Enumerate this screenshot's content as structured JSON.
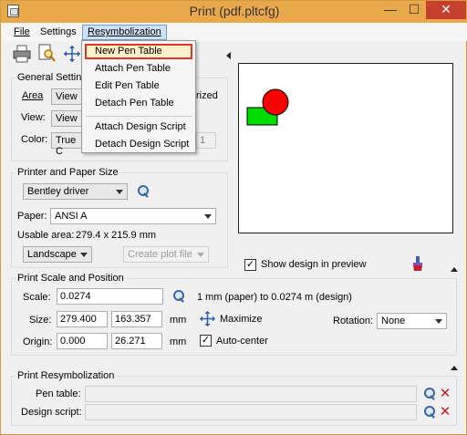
{
  "window": {
    "title": "Print  (pdf.pltcfg)",
    "minimize_glyph": "—",
    "maximize_glyph": "☐",
    "close_glyph": "✕"
  },
  "menubar": {
    "file": "File",
    "settings": "Settings",
    "resymbolization": "Resymbolization"
  },
  "dropdown": {
    "items": [
      "New Pen Table",
      "Attach Pen Table",
      "Edit Pen Table",
      "Detach Pen Table",
      "Attach Design Script",
      "Detach Design Script"
    ],
    "selected": "New Pen Table"
  },
  "toolbar": {
    "icons": [
      "printer-icon",
      "document-preview-icon",
      "fit-icon"
    ]
  },
  "general": {
    "label": "General Setting",
    "area_label": "Area",
    "area_value": "View",
    "view_label": "View:",
    "view_value": "View",
    "color_label": "Color:",
    "color_value": "True C",
    "rized_fragment": "rized",
    "one_fragment": "1"
  },
  "printer": {
    "label": "Printer and Paper Size",
    "driver": "Bentley driver",
    "paper_label": "Paper:",
    "paper_value": "ANSI A",
    "usable_label": "Usable area:",
    "usable_value": "279.4 x 215.9 mm",
    "orientation": "Landscape",
    "create_plot": "Create plot file"
  },
  "preview": {
    "show_design_label": "Show design in preview",
    "show_design_checked": true,
    "circle_color": "#ff0000",
    "rect_color": "#00dd00"
  },
  "scale": {
    "label": "Print Scale and Position",
    "scale_label": "Scale:",
    "scale_value": "0.0274",
    "scale_text": "1 mm (paper) to 0.0274 m (design)",
    "size_label": "Size:",
    "size_x": "279.400",
    "size_y": "163.357",
    "size_unit": "mm",
    "maximize_label": "Maximize",
    "rotation_label": "Rotation:",
    "rotation_value": "None",
    "origin_label": "Origin:",
    "origin_x": "0.000",
    "origin_y": "26.271",
    "origin_unit": "mm",
    "autocenter_label": "Auto-center",
    "autocenter_checked": true
  },
  "resym": {
    "label": "Print Resymbolization",
    "pen_table_label": "Pen table:",
    "pen_table_value": "",
    "design_script_label": "Design script:",
    "design_script_value": ""
  },
  "colors": {
    "titlebar": "#e9a84a",
    "selection_border": "#e0342b"
  }
}
